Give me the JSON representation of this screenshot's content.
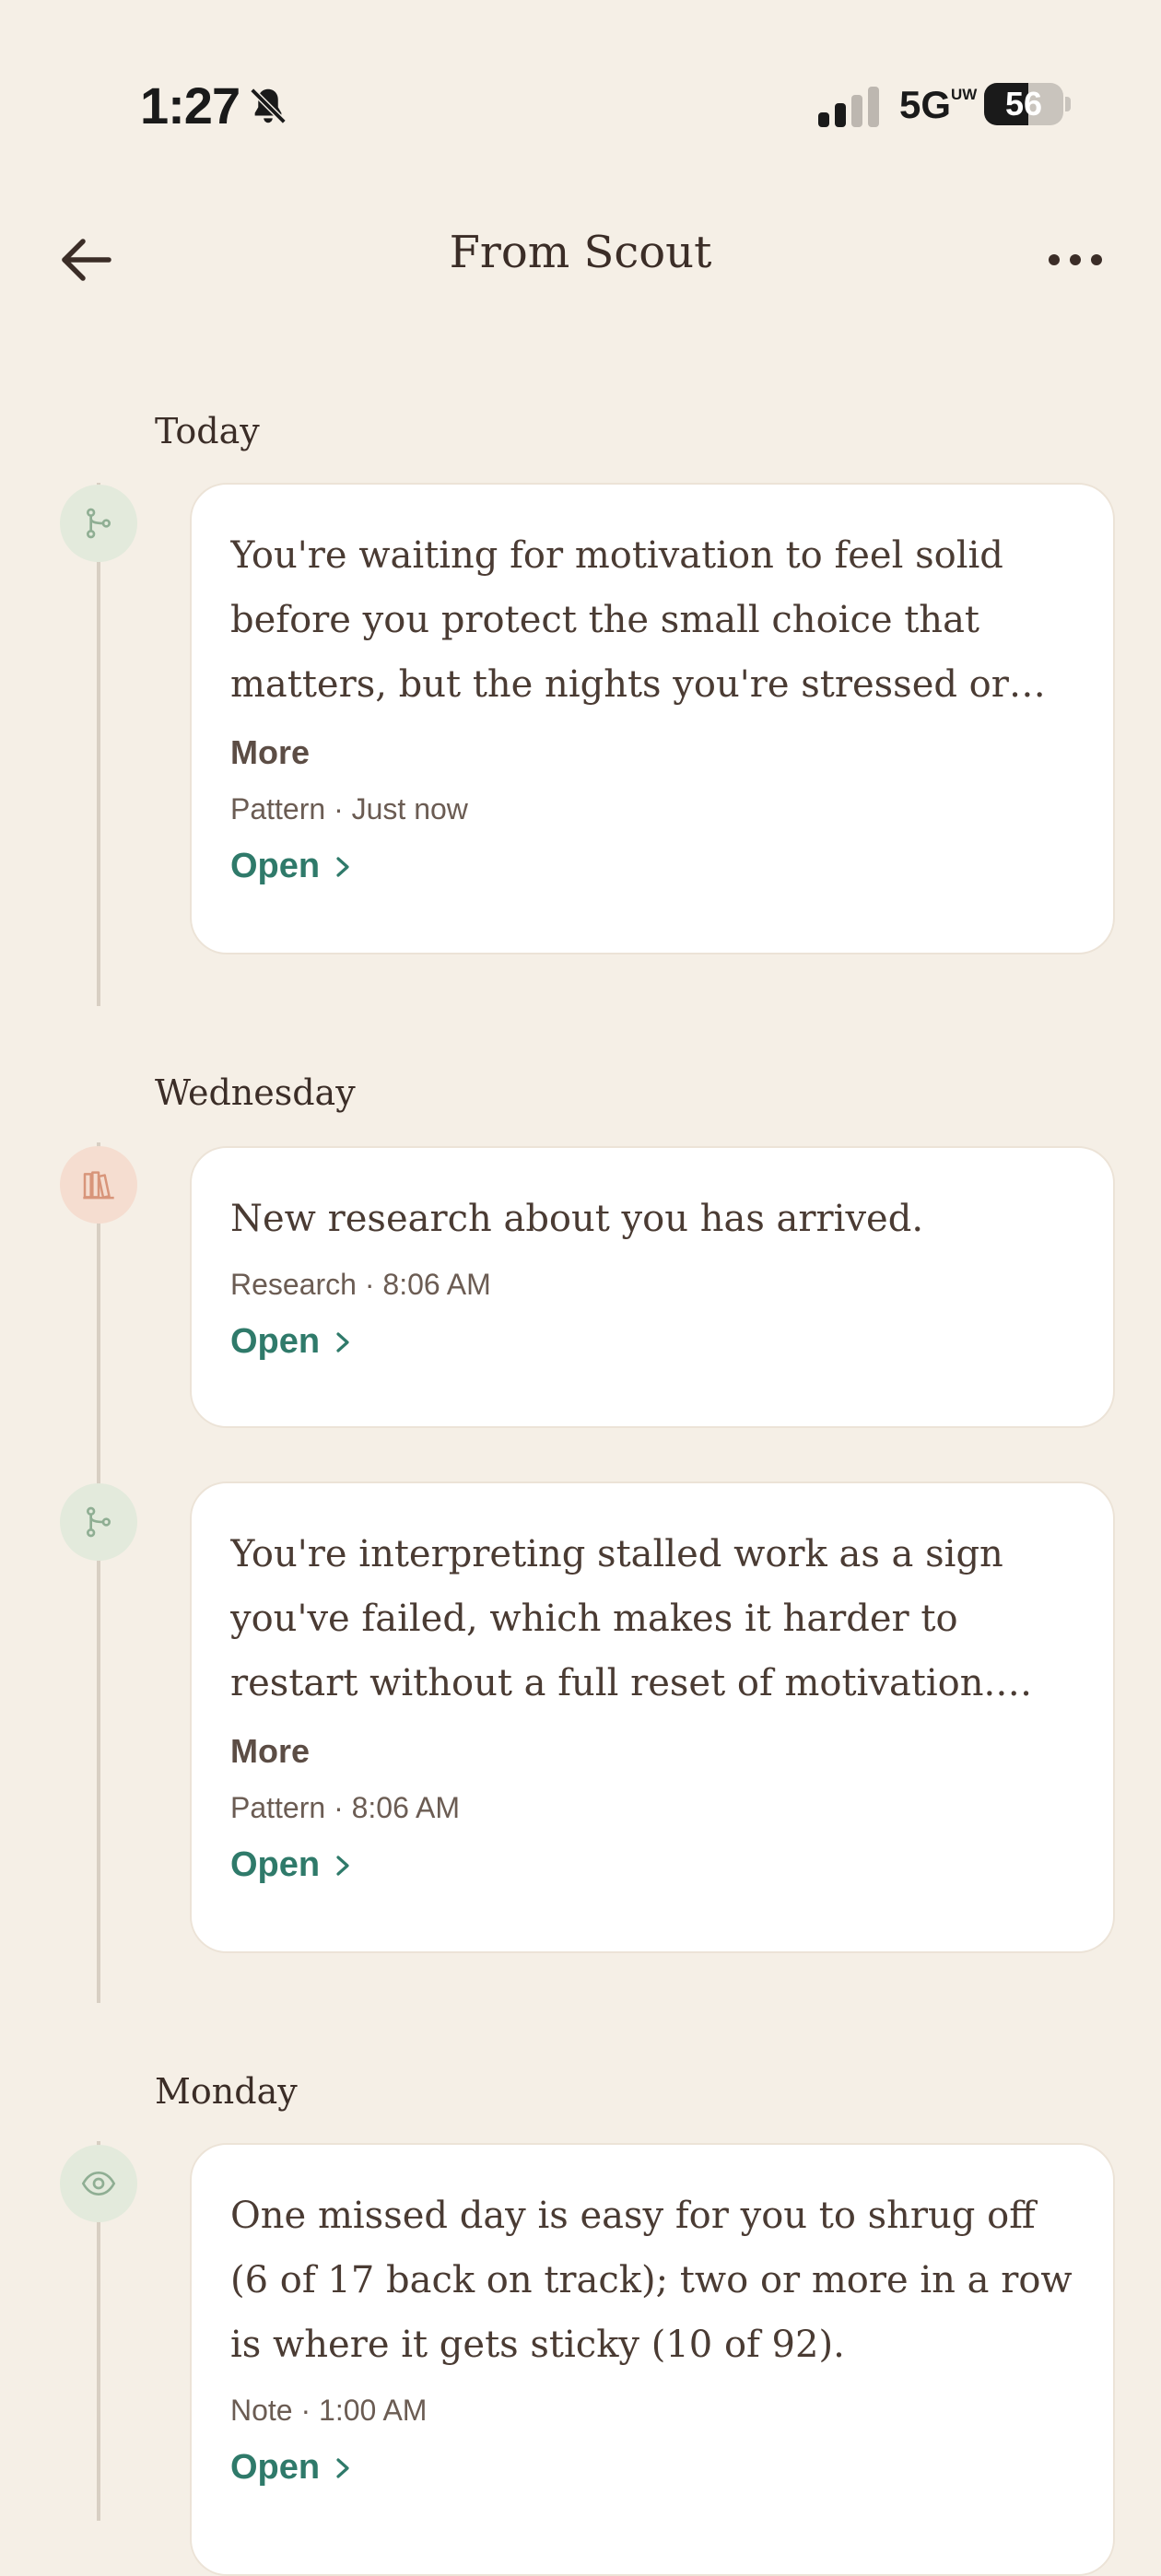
{
  "status_bar": {
    "time": "1:27",
    "network": "5G",
    "network_badge": "UW",
    "battery_level": "56",
    "battery_fraction": 0.56,
    "icons": [
      "bell-muted-icon",
      "cellular-signal-icon",
      "battery-icon"
    ]
  },
  "header": {
    "title": "From Scout",
    "back_icon": "arrow-left-icon",
    "more_icon": "ellipsis-icon"
  },
  "sections": [
    {
      "day": "Today",
      "items": [
        {
          "icon": "branch-icon",
          "text": "You're waiting for motivation to feel solid before you protect the small choice that matters, but the nights you're stressed or tir...",
          "more_label": "More",
          "meta": "Pattern · Just now",
          "open_label": "Open"
        }
      ]
    },
    {
      "day": "Wednesday",
      "items": [
        {
          "icon": "books-icon",
          "text": "New research about you has arrived.",
          "meta": "Research · 8:06 AM",
          "open_label": "Open"
        },
        {
          "icon": "branch-icon",
          "text": "You're interpreting stalled work as a sign you've failed, which makes it harder to restart without a full reset of motivation. This wee...",
          "more_label": "More",
          "meta": "Pattern · 8:06 AM",
          "open_label": "Open"
        }
      ]
    },
    {
      "day": "Monday",
      "items": [
        {
          "icon": "eye-icon",
          "text": "One missed day is easy for you to shrug off (6 of 17 back on track); two or more in a row is where it gets sticky (10 of 92).",
          "meta": "Note · 1:00 AM",
          "open_label": "Open"
        }
      ]
    }
  ],
  "colors": {
    "background": "#f5efe6",
    "card": "#ffffff",
    "accent_green": "#2f7a6a",
    "node_green": "#e3eadc",
    "node_peach": "#f5ddd0"
  }
}
